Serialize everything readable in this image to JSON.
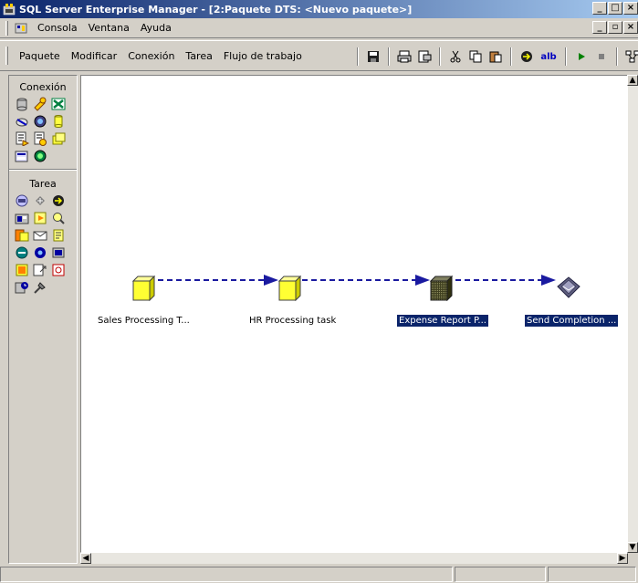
{
  "window": {
    "title": "SQL Server Enterprise Manager - [2:Paquete DTS: <Nuevo paquete>]",
    "controls": [
      "_",
      "□",
      "×"
    ]
  },
  "menubar": {
    "items": [
      "Consola",
      "Ventana",
      "Ayuda"
    ],
    "mdi_controls": [
      "_",
      "▫",
      "×"
    ]
  },
  "toolbar": {
    "menus": [
      "Paquete",
      "Modificar",
      "Conexión",
      "Tarea",
      "Flujo de trabajo"
    ],
    "icons": [
      "save-icon",
      "print-icon",
      "page-setup-icon",
      "cut-icon",
      "copy-icon",
      "paste-icon",
      "transform-icon",
      "text-annotation-icon",
      "run-icon",
      "stop-icon",
      "layout-icon",
      "zoom-icon"
    ],
    "annotation_label": "alb"
  },
  "left_panel": {
    "connection_title": "Conexión",
    "task_title": "Tarea"
  },
  "canvas": {
    "tasks": [
      {
        "label": "Sales Processing T...",
        "selected": false,
        "style": "yellow"
      },
      {
        "label": "HR Processing task",
        "selected": false,
        "style": "yellow"
      },
      {
        "label": "Expense Report P...",
        "selected": true,
        "style": "dark"
      },
      {
        "label": "Send Completion ...",
        "selected": true,
        "style": "mail"
      }
    ]
  },
  "colors": {
    "title_gradient_start": "#0a246a",
    "selection": "#0a246a",
    "cube_yellow": "#ffff33",
    "arrow_blue": "#1a1aa0"
  }
}
